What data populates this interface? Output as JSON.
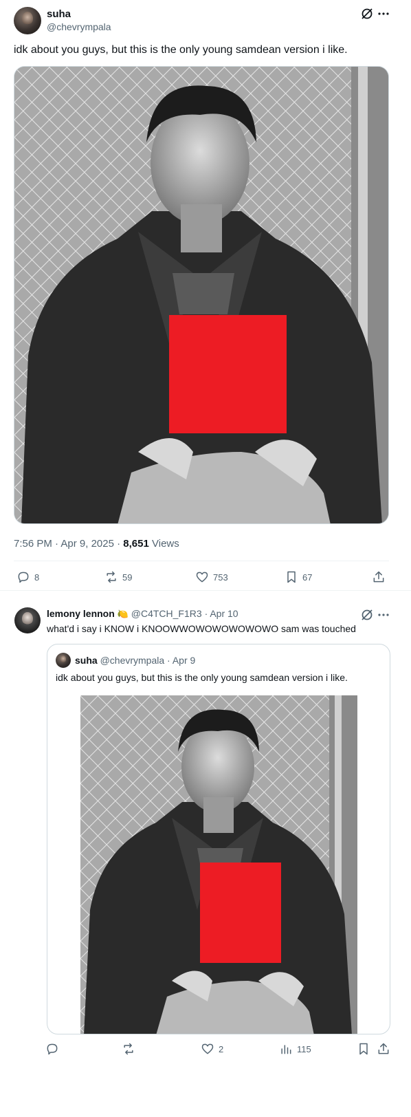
{
  "post": {
    "author_name": "suha",
    "author_handle": "@chevrympala",
    "text": "idk about you guys, but this is the only young samdean version i like.",
    "time": "7:56 PM",
    "date": "Apr 9, 2025",
    "views_count": "8,651",
    "views_label": "Views",
    "stats": {
      "replies": "8",
      "reposts": "59",
      "likes": "753",
      "bookmarks": "67"
    }
  },
  "reply": {
    "author_name": "lemony lennon",
    "author_emoji": "🍋",
    "author_handle": "@C4TCH_F1R3",
    "date": "Apr 10",
    "text": "what'd i say i KNOW i KNOOWWOWOWOWOWOWO sam was touched",
    "quote": {
      "author_name": "suha",
      "author_handle": "@chevrympala",
      "date": "Apr 9",
      "text": "idk about you guys, but this is the only young samdean version i like."
    },
    "stats": {
      "replies": "",
      "reposts": "",
      "likes": "2",
      "views": "115"
    }
  },
  "colors": {
    "redaction": "#ed1c24",
    "muted": "#536471",
    "border": "#cfd9de",
    "accent": "#1d9bf0"
  },
  "icons": [
    "grok-icon",
    "more-icon",
    "reply-icon",
    "repost-icon",
    "like-icon",
    "bookmark-icon",
    "share-icon",
    "views-icon"
  ]
}
